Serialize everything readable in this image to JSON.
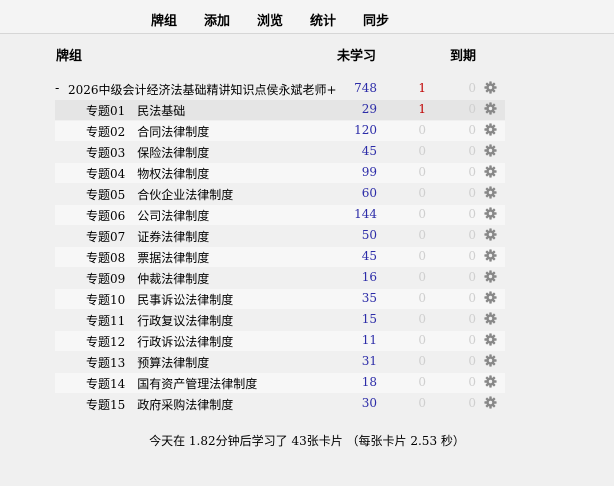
{
  "nav": [
    "牌组",
    "添加",
    "浏览",
    "统计",
    "同步"
  ],
  "headers": {
    "deck": "牌组",
    "new": "未学习",
    "due": "到期"
  },
  "parent": {
    "collapse": "-",
    "name": "2026中级会计经济法基础精讲知识点侯永斌老师+",
    "new": "748",
    "learn": "1",
    "due": "0"
  },
  "decks": [
    {
      "name": "专题01　民法基础",
      "new": "29",
      "learn": "1",
      "due": "0"
    },
    {
      "name": "专题02　合同法律制度",
      "new": "120",
      "learn": "0",
      "due": "0"
    },
    {
      "name": "专题03　保险法律制度",
      "new": "45",
      "learn": "0",
      "due": "0"
    },
    {
      "name": "专题04　物权法律制度",
      "new": "99",
      "learn": "0",
      "due": "0"
    },
    {
      "name": "专题05　合伙企业法律制度",
      "new": "60",
      "learn": "0",
      "due": "0"
    },
    {
      "name": "专题06　公司法律制度",
      "new": "144",
      "learn": "0",
      "due": "0"
    },
    {
      "name": "专题07　证券法律制度",
      "new": "50",
      "learn": "0",
      "due": "0"
    },
    {
      "name": "专题08　票据法律制度",
      "new": "45",
      "learn": "0",
      "due": "0"
    },
    {
      "name": "专题09　仲裁法律制度",
      "new": "16",
      "learn": "0",
      "due": "0"
    },
    {
      "name": "专题10　民事诉讼法律制度",
      "new": "35",
      "learn": "0",
      "due": "0"
    },
    {
      "name": "专题11　行政复议法律制度",
      "new": "15",
      "learn": "0",
      "due": "0"
    },
    {
      "name": "专题12　行政诉讼法律制度",
      "new": "11",
      "learn": "0",
      "due": "0"
    },
    {
      "name": "专题13　预算法律制度",
      "new": "31",
      "learn": "0",
      "due": "0"
    },
    {
      "name": "专题14　国有资产管理法律制度",
      "new": "18",
      "learn": "0",
      "due": "0"
    },
    {
      "name": "专题15　政府采购法律制度",
      "new": "30",
      "learn": "0",
      "due": "0"
    }
  ],
  "footer": "今天在 1.82分钟后学习了 43张卡片 （每张卡片 2.53 秒）",
  "colors": {
    "new": "#2c2ca8",
    "learn": "#c00000",
    "zero": "#cfcfcf",
    "gear": "#888888"
  },
  "icons": {
    "gear": "gear-icon"
  }
}
